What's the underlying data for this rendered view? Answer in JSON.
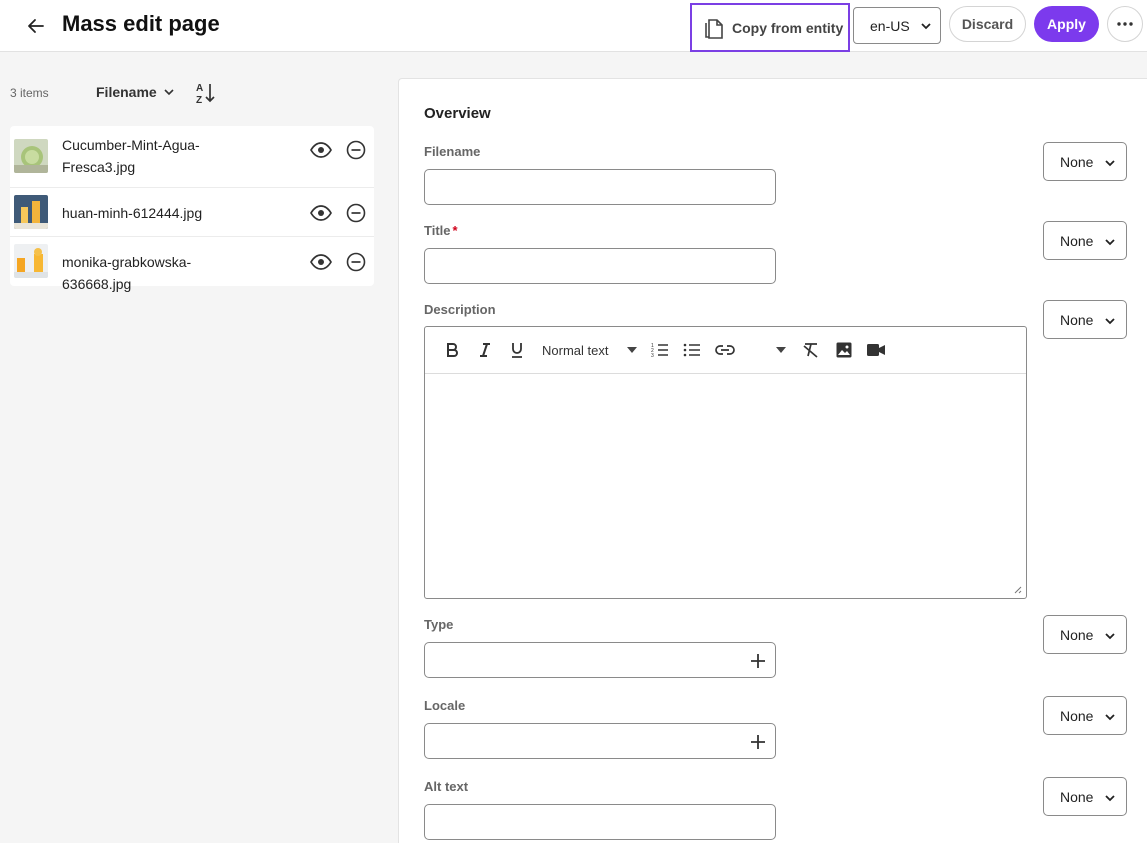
{
  "header": {
    "title": "Mass edit page",
    "copy_label": "Copy from entity",
    "locale": "en-US",
    "discard_label": "Discard",
    "apply_label": "Apply"
  },
  "list": {
    "count": "3 items",
    "sort_field": "Filename",
    "items": [
      {
        "name": "Cucumber-Mint-Agua-Fresca3.jpg",
        "name_line1": "Cucumber-Mint-Agua-",
        "name_line2": "Fresca3.jpg"
      },
      {
        "name": "huan-minh-612444.jpg"
      },
      {
        "name": "monika-grabkowska-636668.jpg"
      }
    ]
  },
  "form": {
    "section_title": "Overview",
    "fields": {
      "filename": {
        "label": "Filename",
        "value": "",
        "mode": "None"
      },
      "title": {
        "label": "Title",
        "required_mark": "*",
        "value": "",
        "mode": "None"
      },
      "description": {
        "label": "Description",
        "mode": "None",
        "format": "Normal text"
      },
      "type": {
        "label": "Type",
        "mode": "None"
      },
      "locale": {
        "label": "Locale",
        "mode": "None"
      },
      "alt_text": {
        "label": "Alt text",
        "value": "",
        "mode": "None"
      }
    }
  },
  "colors": {
    "accent": "#7c3aed",
    "highlight_border": "#7b3fe4",
    "required": "#d0021b"
  },
  "icons": [
    "arrow-left-icon",
    "copy-icon",
    "chevron-down-icon",
    "more-icon",
    "sort-az-icon",
    "eye-icon",
    "minus-circle-icon",
    "bold-icon",
    "italic-icon",
    "underline-icon",
    "ordered-list-icon",
    "bullet-list-icon",
    "link-icon",
    "clear-format-icon",
    "image-icon",
    "video-icon",
    "plus-icon"
  ]
}
